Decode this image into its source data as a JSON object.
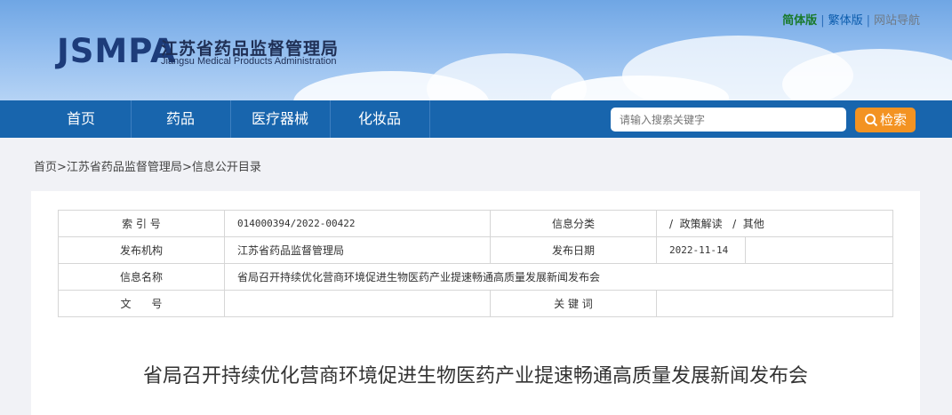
{
  "header": {
    "logo_mark": "JSMPA",
    "logo_cn": "江苏省药品监督管理局",
    "logo_en": "Jiangsu Medical Products Administration",
    "links": {
      "simplified": "简体版",
      "traditional": "繁体版",
      "site_nav": "网站导航",
      "sep": "|"
    }
  },
  "nav": {
    "items": [
      "首页",
      "药品",
      "医疗器械",
      "化妆品"
    ],
    "search_placeholder": "请输入搜索关键字",
    "search_button": "检索"
  },
  "breadcrumb": {
    "home": "首页",
    "sep1": ">",
    "level1": "江苏省药品监督管理局",
    "sep2": ">",
    "level2": "信息公开目录"
  },
  "meta": {
    "index_label": "索 引 号",
    "index_value": "014000394/2022-00422",
    "category_label": "信息分类",
    "category_value": "/  政策解读   /  其他",
    "publisher_label": "发布机构",
    "publisher_value": "江苏省药品监督管理局",
    "date_label": "发布日期",
    "date_value": "2022-11-14",
    "name_label": "信息名称",
    "name_value": "省局召开持续优化营商环境促进生物医药产业提速畅通高质量发展新闻发布会",
    "docno_label": "文      号",
    "docno_value": "",
    "keywords_label": "关 键 词",
    "keywords_value": ""
  },
  "article": {
    "title": "省局召开持续优化营商环境促进生物医药产业提速畅通高质量发展新闻发布会"
  },
  "colors": {
    "nav_bg": "#1865ad",
    "search_button_bg": "#f39322",
    "logo_color": "#1d3c7a"
  }
}
